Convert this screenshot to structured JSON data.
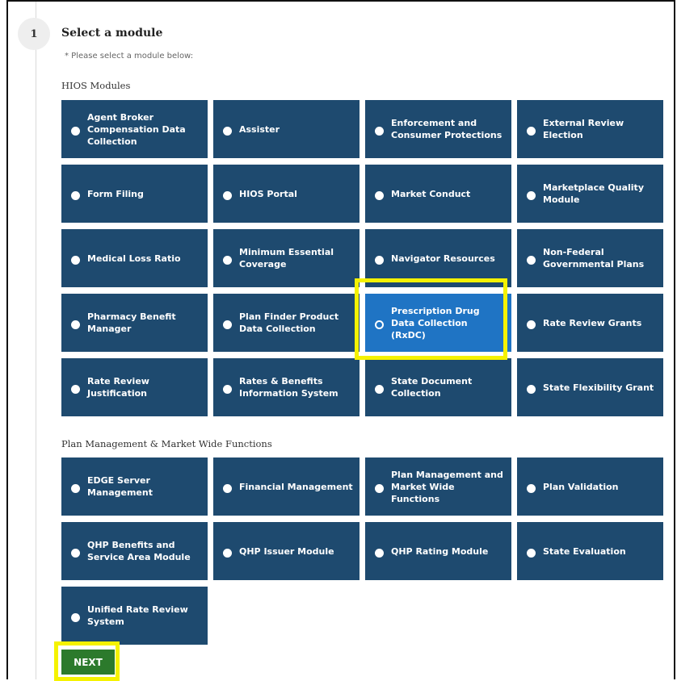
{
  "step": {
    "number": "1",
    "title": "Select a module",
    "hint": "* Please select a module below:"
  },
  "sections": [
    {
      "label": "HIOS Modules",
      "tiles": [
        {
          "label": "Agent Broker Compensation Data Collection",
          "selected": false
        },
        {
          "label": "Assister",
          "selected": false
        },
        {
          "label": "Enforcement and Consumer Protections",
          "selected": false
        },
        {
          "label": "External Review Election",
          "selected": false
        },
        {
          "label": "Form Filing",
          "selected": false
        },
        {
          "label": "HIOS Portal",
          "selected": false
        },
        {
          "label": "Market Conduct",
          "selected": false
        },
        {
          "label": "Marketplace Quality Module",
          "selected": false
        },
        {
          "label": "Medical Loss Ratio",
          "selected": false
        },
        {
          "label": "Minimum Essential Coverage",
          "selected": false
        },
        {
          "label": "Navigator Resources",
          "selected": false
        },
        {
          "label": "Non-Federal Governmental Plans",
          "selected": false
        },
        {
          "label": "Pharmacy Benefit Manager",
          "selected": false
        },
        {
          "label": "Plan Finder Product Data Collection",
          "selected": false
        },
        {
          "label": "Prescription Drug Data Collection (RxDC)",
          "selected": true
        },
        {
          "label": "Rate Review Grants",
          "selected": false
        },
        {
          "label": "Rate Review Justification",
          "selected": false
        },
        {
          "label": "Rates & Benefits Information System",
          "selected": false
        },
        {
          "label": "State Document Collection",
          "selected": false
        },
        {
          "label": "State Flexibility Grant",
          "selected": false
        }
      ]
    },
    {
      "label": "Plan Management & Market Wide Functions",
      "tiles": [
        {
          "label": "EDGE Server Management",
          "selected": false
        },
        {
          "label": "Financial Management",
          "selected": false
        },
        {
          "label": "Plan Management and Market Wide Functions",
          "selected": false
        },
        {
          "label": "Plan Validation",
          "selected": false
        },
        {
          "label": "QHP Benefits and Service Area Module",
          "selected": false
        },
        {
          "label": "QHP Issuer Module",
          "selected": false
        },
        {
          "label": "QHP Rating Module",
          "selected": false
        },
        {
          "label": "State Evaluation",
          "selected": false
        },
        {
          "label": "Unified Rate Review System",
          "selected": false
        }
      ]
    }
  ],
  "next_label": "NEXT",
  "colors": {
    "tile": "#1e4a6f",
    "tile_selected": "#1f74c4",
    "next": "#2c7a2c",
    "highlight": "#f5f200"
  }
}
